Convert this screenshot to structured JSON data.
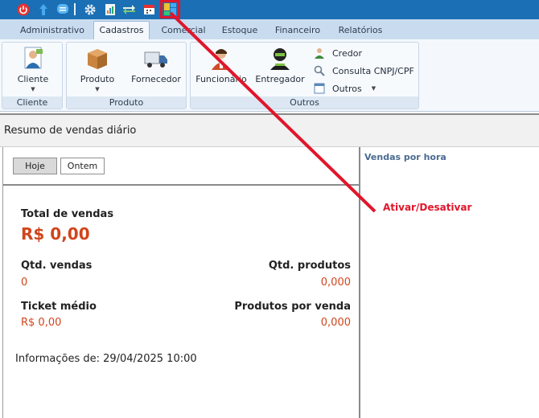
{
  "quick_access": {
    "icons": [
      "power-icon",
      "arrow-up-icon",
      "chat-icon",
      "gear-icon",
      "report-icon",
      "transfer-icon",
      "calendar-icon",
      "layout-toggle-icon"
    ]
  },
  "tabs": [
    {
      "label": "Administrativo"
    },
    {
      "label": "Cadastros"
    },
    {
      "label": "Comercial"
    },
    {
      "label": "Estoque"
    },
    {
      "label": "Financeiro"
    },
    {
      "label": "Relatórios"
    }
  ],
  "ribbon": {
    "groups": {
      "cliente": {
        "label": "Cliente",
        "cliente_btn": "Cliente"
      },
      "produto": {
        "label": "Produto",
        "produto_btn": "Produto",
        "fornecedor_btn": "Fornecedor"
      },
      "outros": {
        "label": "Outros",
        "funcionario_btn": "Funcionário",
        "entregador_btn": "Entregador",
        "credor": "Credor",
        "consulta": "Consulta CNPJ/CPF",
        "outros_menu": "Outros"
      }
    }
  },
  "panel": {
    "title": "Resumo de vendas diário",
    "period_buttons": {
      "today": "Hoje",
      "yesterday": "Ontem"
    },
    "total_label": "Total de vendas",
    "total_value": "R$ 0,00",
    "qtd_vendas_label": "Qtd. vendas",
    "qtd_vendas_value": "0",
    "qtd_produtos_label": "Qtd. produtos",
    "qtd_produtos_value": "0,000",
    "ticket_label": "Ticket médio",
    "ticket_value": "R$ 0,00",
    "prod_por_venda_label": "Produtos por venda",
    "prod_por_venda_value": "0,000",
    "info": "Informações de: 29/04/2025 10:00"
  },
  "right_panel": {
    "title": "Vendas por hora"
  },
  "annotation": {
    "text": "Ativar/Desativar",
    "color": "#e0162b"
  },
  "colors": {
    "accent": "#1a6fb5",
    "value": "#d0451b"
  }
}
